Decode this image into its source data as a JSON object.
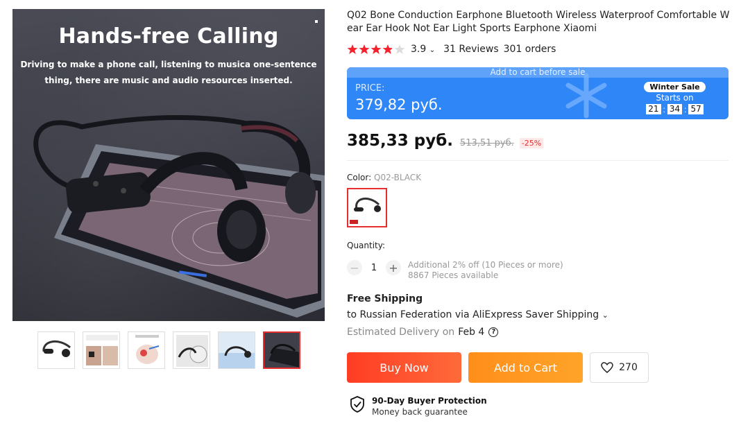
{
  "gallery": {
    "main_headline": "Hands-free Calling",
    "main_subline": "Driving to make a phone call, listening to musica one-sentence thing, there are music and audio resources inserted.",
    "thumbs": [
      {
        "text": ""
      },
      {
        "text": "Get Rid of Traditional In-ear Design, Not Hurt Ears Too!"
      },
      {
        "text": "Bone Conduction"
      },
      {
        "text": "Comfortable to Wear"
      },
      {
        "text": "IPX5 Waterproof"
      },
      {
        "text": "Hands-free Calling"
      }
    ],
    "active_thumb_index": 5
  },
  "product": {
    "title": "Q02 Bone Conduction Earphone Bluetooth Wireless Waterproof Comfortable Wear Ear Hook Not Ear Light Sports Earphone Xiaomi",
    "rating": "3.9",
    "rating_stars": 4,
    "reviews": "31 Reviews",
    "orders": "301 orders"
  },
  "sale": {
    "note": "Add to cart before sale",
    "price_label": "PRICE:",
    "price": "379,82 руб.",
    "badge": "Winter Sale",
    "starts_on": "Starts on",
    "timer": [
      "21",
      "34",
      "57"
    ],
    "accent": "#2f86f6"
  },
  "price": {
    "current": "385,33 руб.",
    "old": "513,51 руб.",
    "discount": "-25%"
  },
  "color": {
    "label": "Color:",
    "value": "Q02-BLACK"
  },
  "quantity": {
    "label": "Quantity:",
    "value": "1",
    "minus": "−",
    "plus": "+",
    "note1": "Additional 2% off (10 Pieces or more)",
    "note2": "8867 Pieces available"
  },
  "shipping": {
    "title": "Free Shipping",
    "dest": "to Russian Federation via AliExpress Saver Shipping",
    "est_label": "Estimated Delivery on",
    "est_date": "Feb 4"
  },
  "actions": {
    "buy": "Buy Now",
    "cart": "Add to Cart",
    "wish_count": "270",
    "buy_color": "#ff3d24",
    "cart_color": "#ff8e1a"
  },
  "protection": {
    "title": "90-Day Buyer Protection",
    "subtitle": "Money back guarantee"
  }
}
